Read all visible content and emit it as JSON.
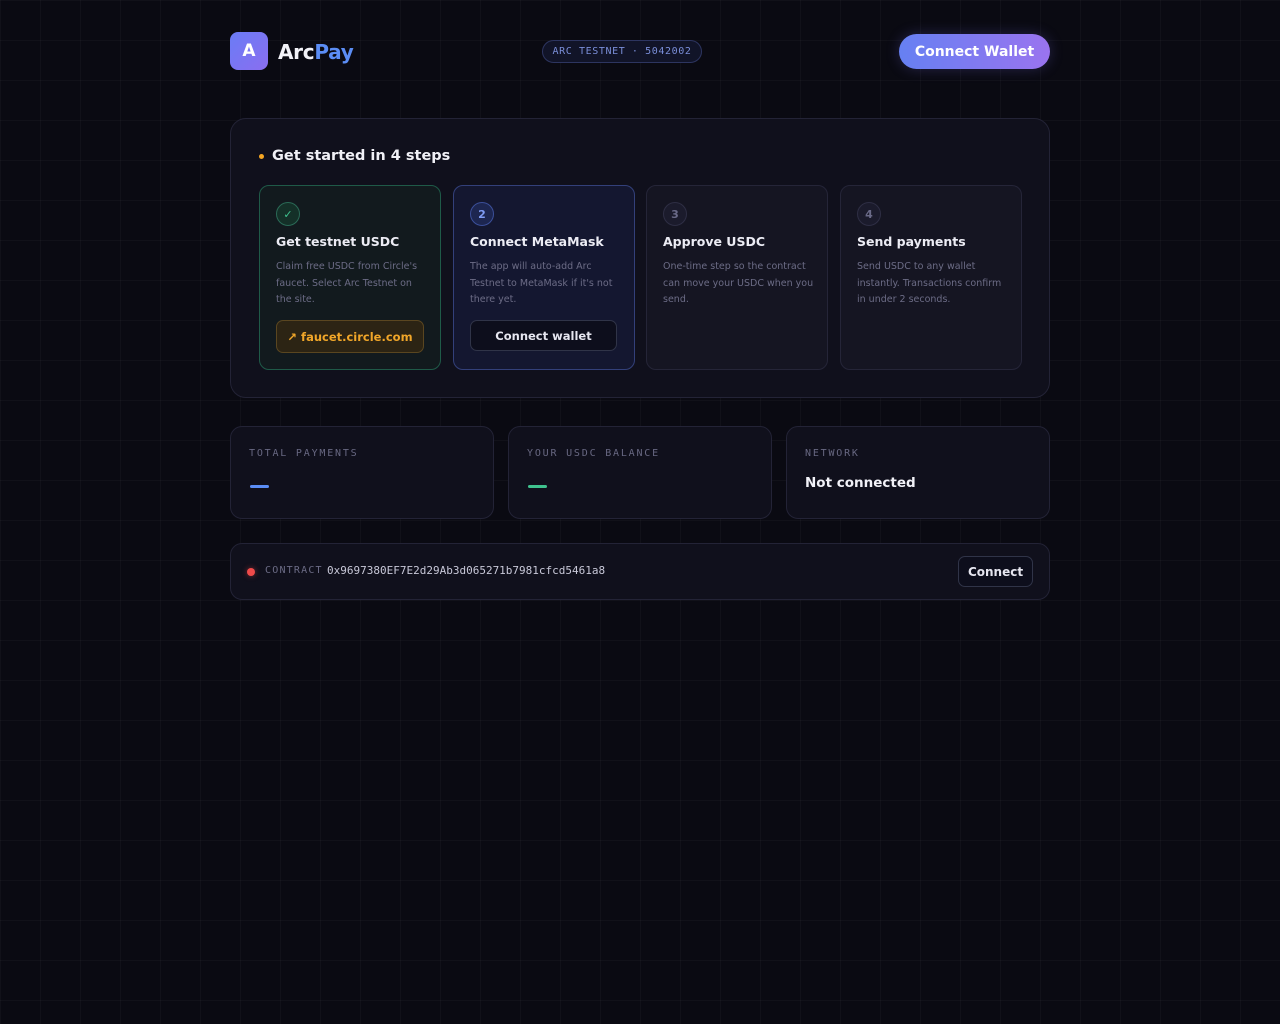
{
  "header": {
    "logo_letter": "A",
    "brand_part1": "Arc",
    "brand_part2": "Pay",
    "network_pill": "ARC TESTNET · 5042002",
    "connect_wallet_label": "Connect Wallet"
  },
  "steps": {
    "title": "Get started in 4 steps",
    "items": [
      {
        "badge": "✓",
        "title": "Get testnet USDC",
        "description": "Claim free USDC from Circle's faucet. Select Arc Testnet on the site.",
        "button_label": "↗ faucet.circle.com",
        "status": "done"
      },
      {
        "badge": "2",
        "title": "Connect MetaMask",
        "description": "The app will auto-add Arc Testnet to MetaMask if it's not there yet.",
        "button_label": "Connect wallet",
        "status": "active"
      },
      {
        "badge": "3",
        "title": "Approve USDC",
        "description": "One-time step so the contract can move your USDC when you send.",
        "status": "pending"
      },
      {
        "badge": "4",
        "title": "Send payments",
        "description": "Send USDC to any wallet instantly. Transactions confirm in under 2 seconds.",
        "status": "pending"
      }
    ]
  },
  "stats": {
    "total_payments_label": "TOTAL PAYMENTS",
    "usdc_balance_label": "YOUR USDC BALANCE",
    "network_label": "NETWORK",
    "network_value": "Not connected"
  },
  "contract": {
    "label": "CONTRACT",
    "address": "0x9697380EF7E2d29Ab3d065271b7981cfcd5461a8",
    "connect_label": "Connect"
  },
  "colors": {
    "accent_blue": "#5b8df5",
    "accent_green": "#3fc28e",
    "accent_orange": "#f0a629",
    "status_red": "#f04a4a"
  }
}
